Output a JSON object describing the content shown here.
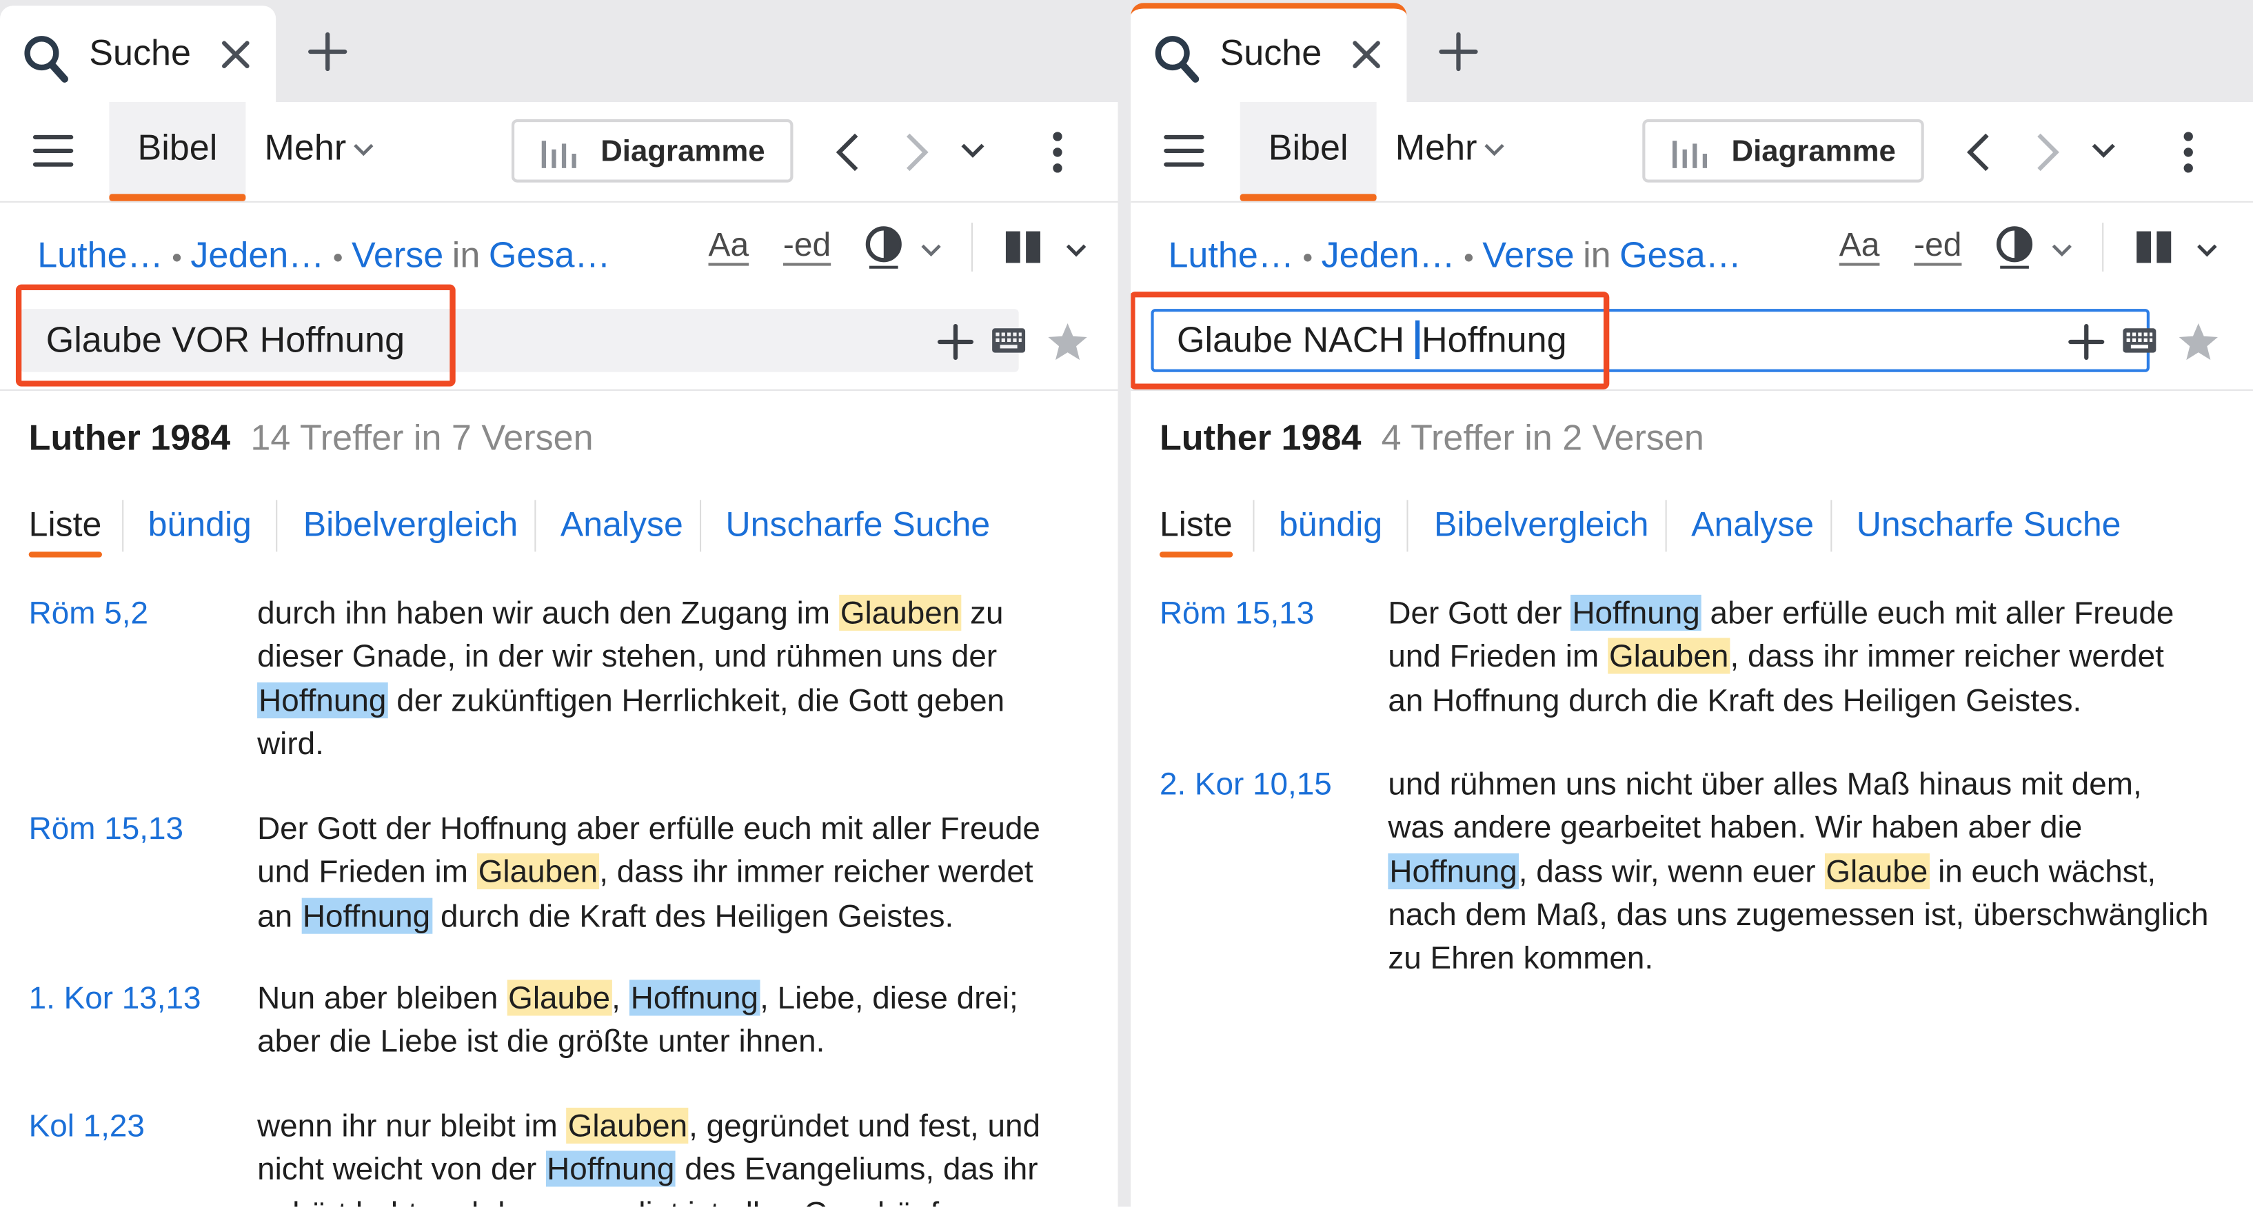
{
  "colors": {
    "accent_orange": "#f26b1d",
    "highlight_frame": "#f04a23",
    "link_blue": "#1a6fd8",
    "glaube_highlight": "#fde9a9",
    "hoffnung_highlight": "#a8d4f7"
  },
  "left": {
    "tab": {
      "label": "Suche",
      "icons": [
        "search-icon",
        "close-icon",
        "add-tab-icon"
      ]
    },
    "toolbar": {
      "bibel": "Bibel",
      "mehr": "Mehr",
      "diagramme": "Diagramme"
    },
    "breadcrumb": {
      "bible": "Luthe…",
      "scope": "Jeden…",
      "unit": "Verse",
      "in": "in",
      "range": "Gesa…"
    },
    "tools": {
      "font": "Aa",
      "ed": "-ed"
    },
    "search": {
      "before": "Glaube VOR Hoffnung",
      "after": ""
    },
    "summary": {
      "version": "Luther 1984",
      "hits": "14 Treffer in 7 Versen"
    },
    "views": [
      "Liste",
      "bündig",
      "Bibelvergleich",
      "Analyse",
      "Unscharfe Suche"
    ],
    "results": [
      {
        "ref": "Röm 5,2",
        "lines": [
          [
            [
              "n",
              "durch ihn haben wir auch den Zugang im "
            ],
            [
              "g",
              "Glauben"
            ],
            [
              "n",
              " zu"
            ]
          ],
          [
            [
              "n",
              "dieser Gnade, in der wir stehen, und rühmen uns der"
            ]
          ],
          [
            [
              "h",
              "Hoffnung"
            ],
            [
              "n",
              " der zukünftigen Herrlichkeit, die Gott geben"
            ]
          ],
          [
            [
              "n",
              "wird."
            ]
          ]
        ]
      },
      {
        "ref": "Röm 15,13",
        "lines": [
          [
            [
              "n",
              "Der Gott der Hoffnung aber erfülle euch mit aller Freude"
            ]
          ],
          [
            [
              "n",
              "und Frieden im "
            ],
            [
              "g",
              "Glauben"
            ],
            [
              "n",
              ", dass ihr immer reicher werdet"
            ]
          ],
          [
            [
              "n",
              "an "
            ],
            [
              "h",
              "Hoffnung"
            ],
            [
              "n",
              " durch die Kraft des Heiligen Geistes."
            ]
          ]
        ]
      },
      {
        "ref": "1. Kor 13,13",
        "lines": [
          [
            [
              "n",
              "Nun aber bleiben "
            ],
            [
              "g",
              "Glaube"
            ],
            [
              "n",
              ", "
            ],
            [
              "h",
              "Hoffnung"
            ],
            [
              "n",
              ", Liebe, diese drei;"
            ]
          ],
          [
            [
              "n",
              "aber die Liebe ist die größte unter ihnen."
            ]
          ]
        ]
      },
      {
        "ref": "Kol 1,23",
        "lines": [
          [
            [
              "n",
              "wenn ihr nur bleibt im "
            ],
            [
              "g",
              "Glauben"
            ],
            [
              "n",
              ", gegründet und fest, und"
            ]
          ],
          [
            [
              "n",
              "nicht weicht von der "
            ],
            [
              "h",
              "Hoffnung"
            ],
            [
              "n",
              " des Evangeliums, das ihr"
            ]
          ],
          [
            [
              "n",
              "gehört habt und das gepredigt ist allen Geschöpfen"
            ]
          ]
        ]
      }
    ]
  },
  "right": {
    "tab": {
      "label": "Suche",
      "icons": [
        "search-icon",
        "close-icon",
        "add-tab-icon"
      ]
    },
    "toolbar": {
      "bibel": "Bibel",
      "mehr": "Mehr",
      "diagramme": "Diagramme"
    },
    "breadcrumb": {
      "bible": "Luthe…",
      "scope": "Jeden…",
      "unit": "Verse",
      "in": "in",
      "range": "Gesa…"
    },
    "tools": {
      "font": "Aa",
      "ed": "-ed"
    },
    "search": {
      "before": "Glaube NACH ",
      "after": "Hoffnung"
    },
    "summary": {
      "version": "Luther 1984",
      "hits": "4 Treffer in 2 Versen"
    },
    "views": [
      "Liste",
      "bündig",
      "Bibelvergleich",
      "Analyse",
      "Unscharfe Suche"
    ],
    "results": [
      {
        "ref": "Röm 15,13",
        "lines": [
          [
            [
              "n",
              "Der Gott der "
            ],
            [
              "h",
              "Hoffnung"
            ],
            [
              "n",
              " aber erfülle euch mit aller Freude"
            ]
          ],
          [
            [
              "n",
              "und Frieden im "
            ],
            [
              "g",
              "Glauben"
            ],
            [
              "n",
              ", dass ihr immer reicher werdet"
            ]
          ],
          [
            [
              "n",
              "an Hoffnung durch die Kraft des Heiligen Geistes."
            ]
          ]
        ]
      },
      {
        "ref": "2. Kor 10,15",
        "lines": [
          [
            [
              "n",
              "und rühmen uns nicht über alles Maß hinaus mit dem,"
            ]
          ],
          [
            [
              "n",
              "was andere gearbeitet haben. Wir haben aber die"
            ]
          ],
          [
            [
              "h",
              "Hoffnung"
            ],
            [
              "n",
              ", dass wir, wenn euer "
            ],
            [
              "g",
              "Glaube"
            ],
            [
              "n",
              " in euch wächst,"
            ]
          ],
          [
            [
              "n",
              "nach dem Maß, das uns zugemessen ist, überschwänglich"
            ]
          ],
          [
            [
              "n",
              "zu Ehren kommen."
            ]
          ]
        ]
      }
    ]
  }
}
